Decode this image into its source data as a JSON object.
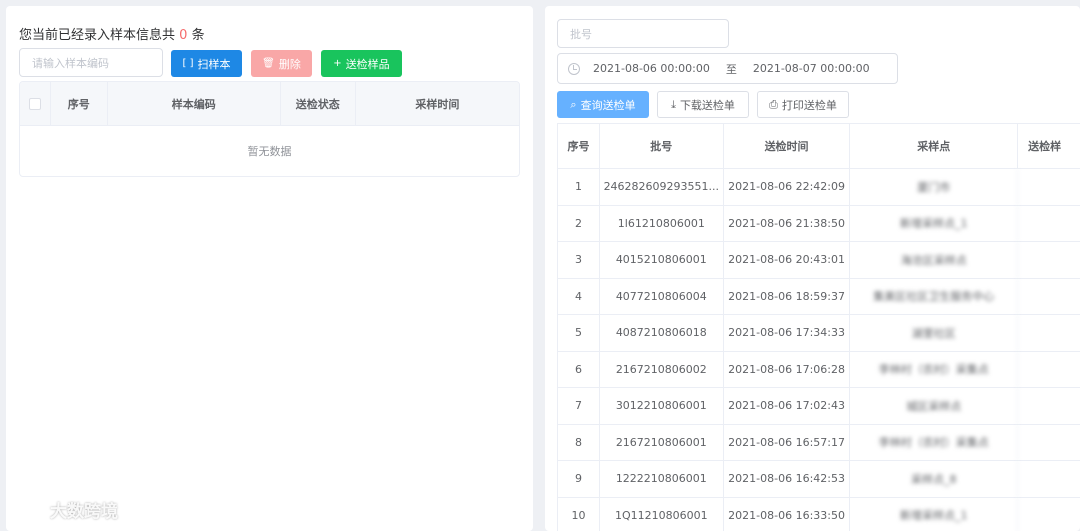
{
  "left": {
    "summary_prefix": "您当前已经录入样本信息共",
    "summary_count": "0",
    "summary_suffix": "条",
    "sample_input_placeholder": "请输入样本编码",
    "scan_label": "扫样本",
    "delete_label": "删除",
    "send_label": "送检样品",
    "columns": [
      "序号",
      "样本编码",
      "送检状态",
      "采样时间"
    ],
    "empty_text": "暂无数据"
  },
  "right": {
    "batch_placeholder": "批号",
    "date_start": "2021-08-06 00:00:00",
    "date_sep": "至",
    "date_end": "2021-08-07 00:00:00",
    "query_label": "查询送检单",
    "download_label": "下载送检单",
    "print_label": "打印送检单",
    "columns": [
      "序号",
      "批号",
      "送检时间",
      "采样点",
      "送检样"
    ],
    "rows": [
      {
        "idx": "1",
        "batch": "246282609293551...",
        "time": "2021-08-06 22:42:09",
        "site": "厦门市"
      },
      {
        "idx": "2",
        "batch": "1l61210806001",
        "time": "2021-08-06 21:38:50",
        "site": "新增采样点_1"
      },
      {
        "idx": "3",
        "batch": "4015210806001",
        "time": "2021-08-06 20:43:01",
        "site": "海沧区采样点"
      },
      {
        "idx": "4",
        "batch": "4077210806004",
        "time": "2021-08-06 18:59:37",
        "site": "集美区社区卫生服务中心"
      },
      {
        "idx": "5",
        "batch": "4087210806018",
        "time": "2021-08-06 17:34:33",
        "site": "湖里社区"
      },
      {
        "idx": "6",
        "batch": "2167210806002",
        "time": "2021-08-06 17:06:28",
        "site": "李林村（农村）采集点"
      },
      {
        "idx": "7",
        "batch": "3012210806001",
        "time": "2021-08-06 17:02:43",
        "site": "城区采样点"
      },
      {
        "idx": "8",
        "batch": "2167210806001",
        "time": "2021-08-06 16:57:17",
        "site": "李林村（农村）采集点"
      },
      {
        "idx": "9",
        "batch": "1222210806001",
        "time": "2021-08-06 16:42:53",
        "site": "采样点_8"
      },
      {
        "idx": "10",
        "batch": "1Q11210806001",
        "time": "2021-08-06 16:33:50",
        "site": "新增采样点_1"
      }
    ]
  },
  "watermark": "大数跨境"
}
